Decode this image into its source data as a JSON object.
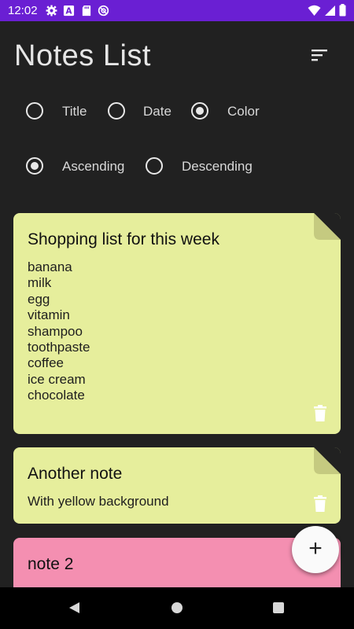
{
  "status_bar": {
    "time": "12:02",
    "icons": [
      "settings-icon",
      "a-icon",
      "sd-card-icon",
      "no-disturb-icon"
    ],
    "right_icons": [
      "wifi-icon",
      "signal-icon",
      "battery-icon"
    ],
    "color": "#6a1fd3"
  },
  "header": {
    "title": "Notes List",
    "sort_icon": "sort-icon"
  },
  "sort_field": {
    "options": [
      {
        "label": "Title",
        "selected": false
      },
      {
        "label": "Date",
        "selected": false
      },
      {
        "label": "Color",
        "selected": true
      }
    ]
  },
  "sort_order": {
    "options": [
      {
        "label": "Ascending",
        "selected": true
      },
      {
        "label": "Descending",
        "selected": false
      }
    ]
  },
  "notes": [
    {
      "title": "Shopping list for this week",
      "lines": [
        "banana",
        "milk",
        "egg",
        "vitamin",
        "shampoo",
        "toothpaste",
        "coffee",
        "ice cream",
        "chocolate"
      ],
      "color": "#e6ee9c"
    },
    {
      "title": "Another note",
      "lines": [
        "With yellow background"
      ],
      "color": "#e6ee9c"
    },
    {
      "title": "note 2",
      "lines": [],
      "color": "#f48fb1"
    }
  ],
  "fab": {
    "label": "+"
  },
  "colors": {
    "background": "#212121",
    "fold_yellow": "#c5ca80",
    "trash": "#ffffff"
  }
}
